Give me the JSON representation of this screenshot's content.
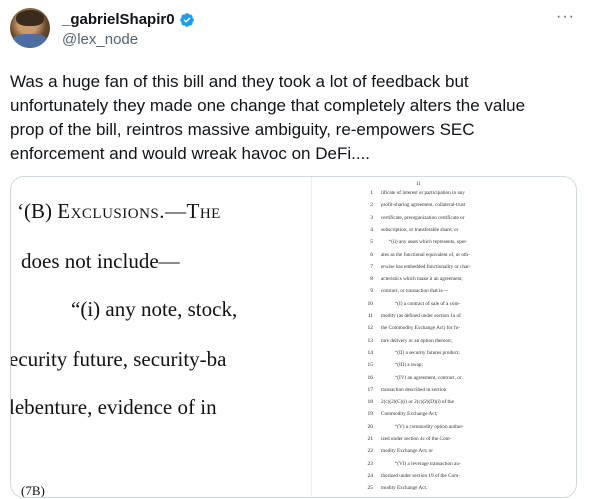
{
  "author": {
    "display_name": "_gabrielShapir0",
    "handle": "@lex_node",
    "verified_icon": "verified-badge-icon"
  },
  "more_label": "···",
  "tweet": {
    "text": "Was a huge fan of this bill and they took a lot of feedback but\nunfortunately they made one change that completely alters the value\nprop of the bill, reintros massive ambiguity, re-empowers SEC\nenforcement and would wreak havoc on DeFi...."
  },
  "left_doc": {
    "lines": [
      {
        "text": "‘(B) "
      },
      {
        "text": "does not include—"
      },
      {
        "text": "“(i)  any  note,  stock,"
      },
      {
        "text": "ecurity  future,  security-ba"
      },
      {
        "text": "lebenture,  evidence  of  in"
      },
      {
        "text": "(7B)"
      }
    ],
    "exclusions": "Exclusions.—The"
  },
  "right_doc": {
    "page_number": "11",
    "lines": [
      {
        "n": "1",
        "t": "tificate of interest or participation in any"
      },
      {
        "n": "2",
        "t": "profit-sharing agreement, collateral-trust"
      },
      {
        "n": "3",
        "t": "certificate, preorganization certificate or"
      },
      {
        "n": "4",
        "t": "subscription, or transferable share; or"
      },
      {
        "n": "5",
        "t": "“(ii) any asset which represents, oper-"
      },
      {
        "n": "6",
        "t": "ates as the functional equivalent of, or oth-"
      },
      {
        "n": "7",
        "t": "erwise has embedded functionality or char-"
      },
      {
        "n": "8",
        "t": "acteristics which make it an agreement,"
      },
      {
        "n": "9",
        "t": "contract, or transaction that is—"
      },
      {
        "n": "10",
        "t": "“(I) a contract of sale of a com-"
      },
      {
        "n": "11",
        "t": "modity (as defined under section 1a of"
      },
      {
        "n": "12",
        "t": "the Commodity Exchange Act) for fu-"
      },
      {
        "n": "13",
        "t": "ture delivery or an option thereon;"
      },
      {
        "n": "14",
        "t": "“(II) a security futures product;"
      },
      {
        "n": "15",
        "t": "“(III) a swap;"
      },
      {
        "n": "16",
        "t": "“(IV) an agreement, contract, or"
      },
      {
        "n": "17",
        "t": "transaction described in section"
      },
      {
        "n": "18",
        "t": "2(c)(2)(C)(i) or 2(c)(2)(D)(i) of the"
      },
      {
        "n": "19",
        "t": "Commodity Exchange Act;"
      },
      {
        "n": "20",
        "t": "“(V) a commodity option author-"
      },
      {
        "n": "21",
        "t": "ized under section 4c of the Com-"
      },
      {
        "n": "22",
        "t": "modity Exchange Act; or"
      },
      {
        "n": "23",
        "t": "“(VI) a leverage transaction au-"
      },
      {
        "n": "24",
        "t": "thorized under section 19 of the Com-"
      },
      {
        "n": "25",
        "t": "modity Exchange Act."
      }
    ]
  }
}
